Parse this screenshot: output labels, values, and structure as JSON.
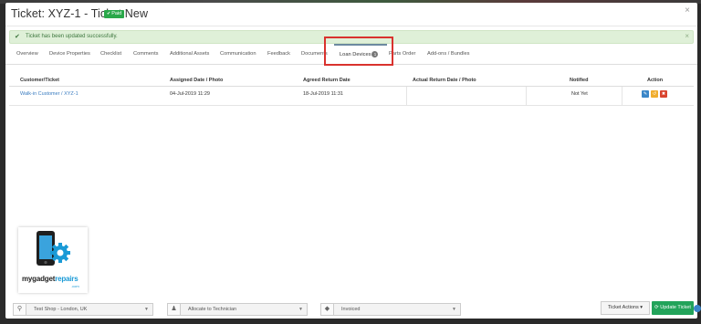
{
  "modal": {
    "title": "Ticket: XYZ-1 - Ticket New",
    "badge": "Paid",
    "close": "×"
  },
  "alert": {
    "message": "Ticket has been updated successfully.",
    "dismiss": "×"
  },
  "tabs": [
    {
      "label": "Overview"
    },
    {
      "label": "Device Properties"
    },
    {
      "label": "Checklist"
    },
    {
      "label": "Comments"
    },
    {
      "label": "Additional Assets"
    },
    {
      "label": "Communication"
    },
    {
      "label": "Feedback"
    },
    {
      "label": "Documents"
    },
    {
      "label": "Loan Devices",
      "count": "1",
      "active": true
    },
    {
      "label": "Parts Order"
    },
    {
      "label": "Add-ons / Bundles"
    }
  ],
  "table": {
    "headers": {
      "customer": "Customer/Ticket",
      "assigned": "Assigned Date / Photo",
      "agreed": "Agreed Return Date",
      "actual": "Actual Return Date / Photo",
      "notified": "Notified",
      "action": "Action"
    },
    "rows": [
      {
        "customer": "Walk-in Customer / XYZ-1",
        "assigned": "04-Jul-2019 11:29",
        "agreed": "18-Jul-2019 11:31",
        "actual": "",
        "notified": "Not Yet"
      }
    ]
  },
  "logo": {
    "text_black": "mygadget",
    "text_blue": "repairs",
    "suffix": ".com"
  },
  "footer": {
    "location": "Test Shop - London, UK",
    "technician": "Allocate to Technician",
    "status": "Invoiced",
    "actions_label": "Ticket Actions",
    "update_label": "Update Ticket"
  },
  "colors": {
    "success": "#22a35a",
    "highlight": "#d9322e",
    "link": "#3a7cc0"
  }
}
